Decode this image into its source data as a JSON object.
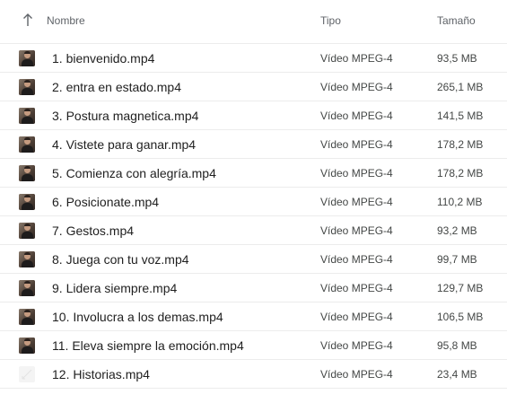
{
  "header": {
    "name": "Nombre",
    "type": "Tipo",
    "size": "Tamaño"
  },
  "files": [
    {
      "name": "1. bienvenido.mp4",
      "type": "Vídeo MPEG-4",
      "size": "93,5 MB",
      "thumb": "video-thumbnail-icon"
    },
    {
      "name": "2. entra en estado.mp4",
      "type": "Vídeo MPEG-4",
      "size": "265,1 MB",
      "thumb": "video-thumbnail-icon"
    },
    {
      "name": "3. Postura magnetica.mp4",
      "type": "Vídeo MPEG-4",
      "size": "141,5 MB",
      "thumb": "video-thumbnail-icon"
    },
    {
      "name": "4. Vistete para ganar.mp4",
      "type": "Vídeo MPEG-4",
      "size": "178,2 MB",
      "thumb": "video-thumbnail-icon"
    },
    {
      "name": "5. Comienza con alegría.mp4",
      "type": "Vídeo MPEG-4",
      "size": "178,2 MB",
      "thumb": "video-thumbnail-icon"
    },
    {
      "name": "6. Posicionate.mp4",
      "type": "Vídeo MPEG-4",
      "size": "110,2 MB",
      "thumb": "video-thumbnail-icon"
    },
    {
      "name": "7. Gestos.mp4",
      "type": "Vídeo MPEG-4",
      "size": "93,2 MB",
      "thumb": "video-thumbnail-icon"
    },
    {
      "name": "8. Juega con tu voz.mp4",
      "type": "Vídeo MPEG-4",
      "size": "99,7 MB",
      "thumb": "video-thumbnail-icon"
    },
    {
      "name": "9. Lidera siempre.mp4",
      "type": "Vídeo MPEG-4",
      "size": "129,7 MB",
      "thumb": "video-thumbnail-icon"
    },
    {
      "name": "10. Involucra a los demas.mp4",
      "type": "Vídeo MPEG-4",
      "size": "106,5 MB",
      "thumb": "video-thumbnail-icon"
    },
    {
      "name": "11. Eleva siempre la emoción.mp4",
      "type": "Vídeo MPEG-4",
      "size": "95,8 MB",
      "thumb": "video-thumbnail-icon"
    },
    {
      "name": "12. Historias.mp4",
      "type": "Vídeo MPEG-4",
      "size": "23,4 MB",
      "thumb": "blank-thumbnail-icon"
    }
  ],
  "colors": {
    "text_primary": "#1f1f1f",
    "text_secondary": "#444746",
    "divider": "#ececec"
  }
}
